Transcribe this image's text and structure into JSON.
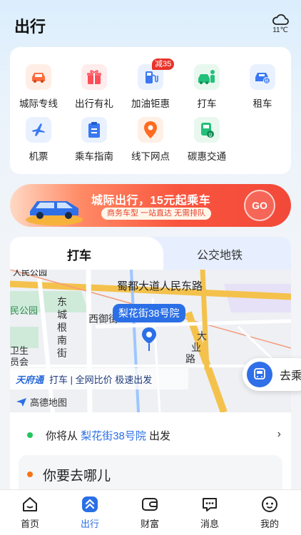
{
  "header": {
    "title": "出行",
    "weather_icon": "cloud-icon",
    "temperature": "11℃"
  },
  "services": [
    {
      "label": "城际专线",
      "icon": "car-front-icon",
      "color": "#ff6b3d"
    },
    {
      "label": "出行有礼",
      "icon": "gift-icon",
      "color": "#ff4d5a"
    },
    {
      "label": "加油钜惠",
      "icon": "fuel-pump-icon",
      "color": "#3a78f2",
      "badge": "减35"
    },
    {
      "label": "打车",
      "icon": "taxi-person-icon",
      "color": "#22c07a"
    },
    {
      "label": "租车",
      "icon": "rental-car-icon",
      "color": "#3a78f2"
    },
    {
      "label": "机票",
      "icon": "airplane-icon",
      "color": "#3a78f2"
    },
    {
      "label": "乘车指南",
      "icon": "clipboard-icon",
      "color": "#3a78f2"
    },
    {
      "label": "线下网点",
      "icon": "location-pin-icon",
      "color": "#ff6b1f"
    },
    {
      "label": "碳惠交通",
      "icon": "green-transit-icon",
      "color": "#22c07a"
    }
  ],
  "banner": {
    "title": "城际出行，15元起乘车",
    "subtitle": "商务车型 一站直达 无需排队",
    "go": "GO"
  },
  "tabs": {
    "active": "打车",
    "other": "公交地铁"
  },
  "map": {
    "pin_label": "梨花街38号院",
    "labels": [
      "蜀都大道人民东路",
      "人民公园",
      "东城根南街",
      "西御街",
      "大业路",
      "民公园",
      "卫生",
      "员会"
    ],
    "promo_brand": "天府通",
    "promo_text": "打车 | 全网比价 极速出发",
    "provider": "高德地图"
  },
  "float_button": {
    "label": "去乘"
  },
  "trip": {
    "from_prefix": "你将从",
    "from_place": "梨花街38号院",
    "from_suffix": "出发",
    "to_placeholder": "你要去哪儿"
  },
  "tabbar": [
    {
      "label": "首页",
      "icon": "home-icon"
    },
    {
      "label": "出行",
      "icon": "travel-icon",
      "active": true
    },
    {
      "label": "财富",
      "icon": "wallet-icon"
    },
    {
      "label": "消息",
      "icon": "message-icon"
    },
    {
      "label": "我的",
      "icon": "profile-icon"
    }
  ]
}
